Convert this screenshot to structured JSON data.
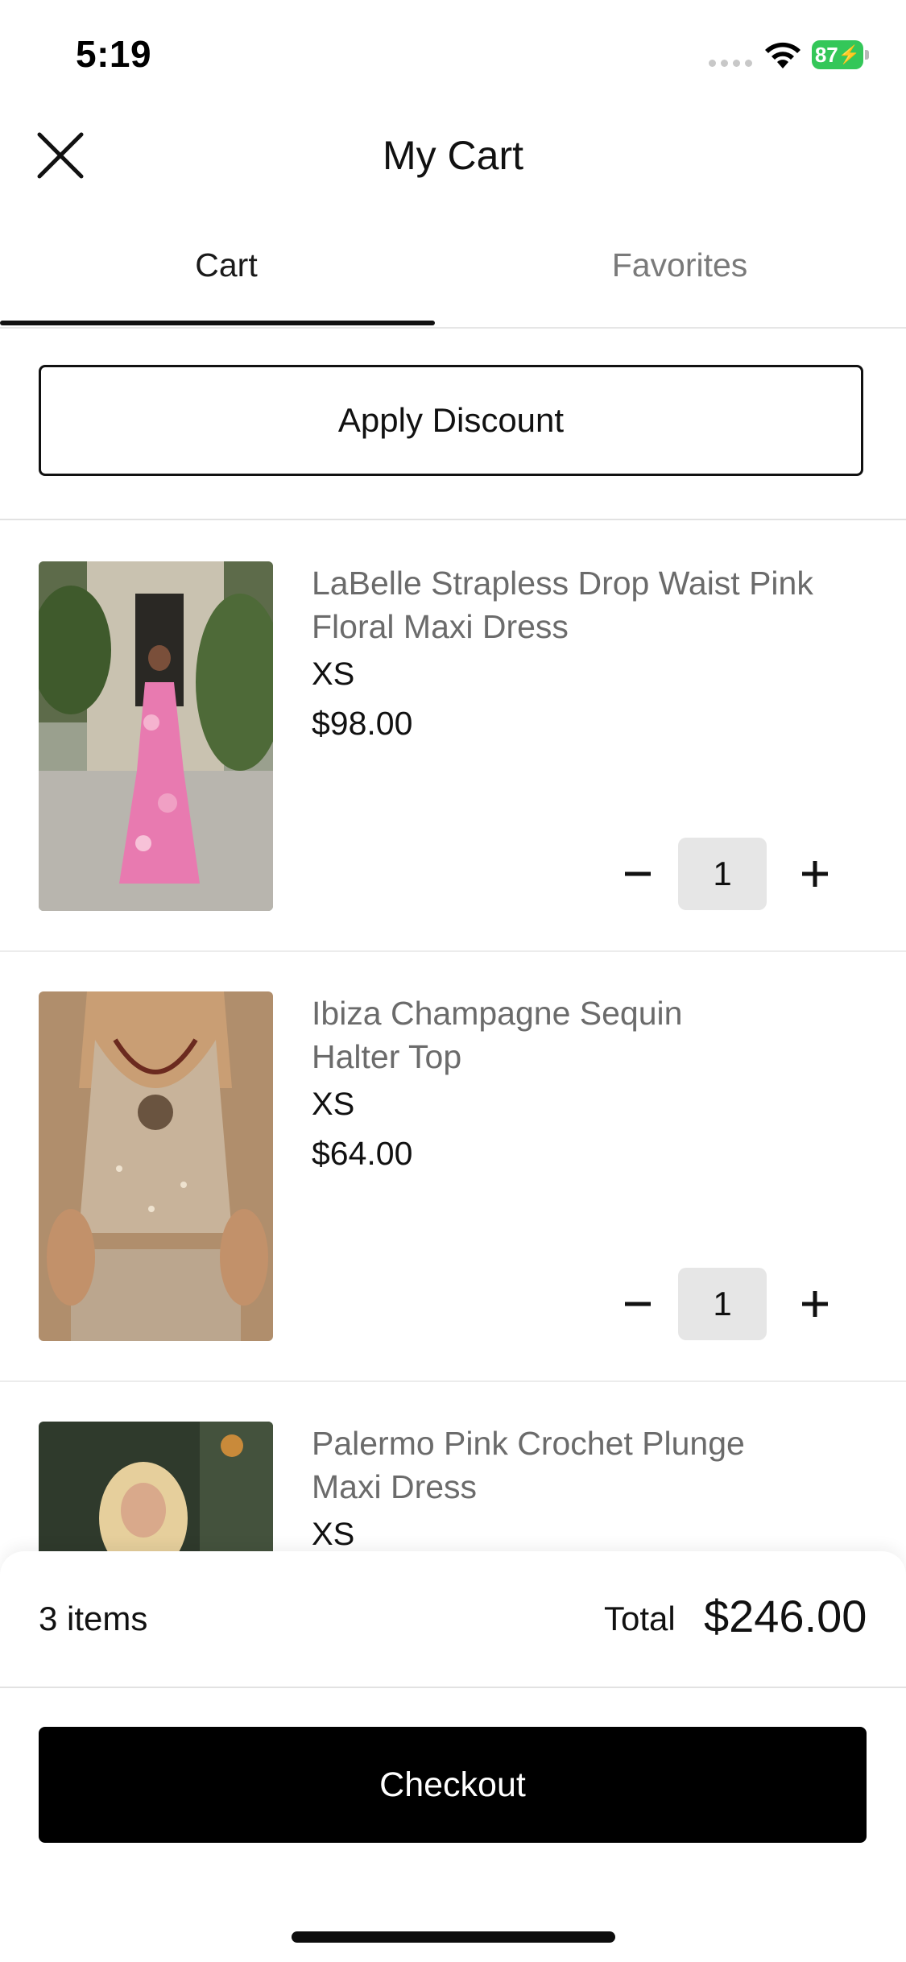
{
  "status_bar": {
    "time": "5:19",
    "battery": "87",
    "battery_color": "#34c759"
  },
  "header": {
    "title": "My Cart",
    "close_icon": "close-icon"
  },
  "tabs": [
    {
      "label": "Cart",
      "active": true
    },
    {
      "label": "Favorites",
      "active": false
    }
  ],
  "discount": {
    "label": "Apply Discount"
  },
  "items": [
    {
      "name": "LaBelle Strapless Drop Waist Pink Floral Maxi Dress",
      "size": "XS",
      "price": "$98.00",
      "quantity": "1"
    },
    {
      "name": "Ibiza Champagne Sequin Halter Top",
      "size": "XS",
      "price": "$64.00",
      "quantity": "1"
    },
    {
      "name": "Palermo Pink Crochet Plunge Maxi Dress",
      "size": "XS"
    }
  ],
  "summary": {
    "items_count": "3 items",
    "total_label": "Total",
    "total_amount": "$246.00"
  },
  "checkout": {
    "label": "Checkout"
  }
}
